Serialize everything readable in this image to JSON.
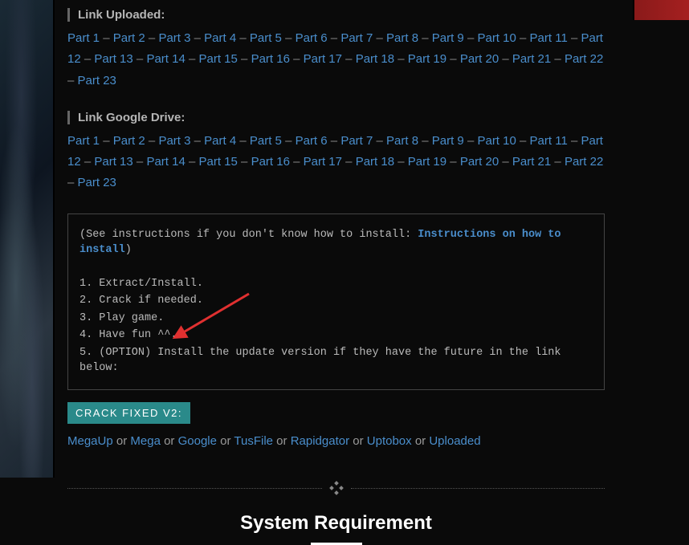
{
  "uploaded": {
    "label": "Link Uploaded:",
    "total_parts": 23
  },
  "gdrive": {
    "label": "Link Google Drive:",
    "total_parts": 23
  },
  "part_separator": " – ",
  "part_prefix": "Part ",
  "instructions": {
    "prefix": "(See instructions if you don't know how to install: ",
    "link_text": "Instructions on how to install",
    "suffix": ")",
    "steps": [
      "Extract/Install.",
      "Crack if needed.",
      "Play game.",
      "Have fun ^^.",
      "(OPTION) Install the update version if they have the future in the link below:"
    ]
  },
  "crack_button": "CRACK FIXED V2:",
  "mirrors": {
    "or": " or ",
    "links": [
      "MegaUp",
      "Mega",
      "Google",
      "TusFile",
      "Rapidgator",
      "Uptobox",
      "Uploaded"
    ]
  },
  "system_requirement_heading": "System Requirement"
}
